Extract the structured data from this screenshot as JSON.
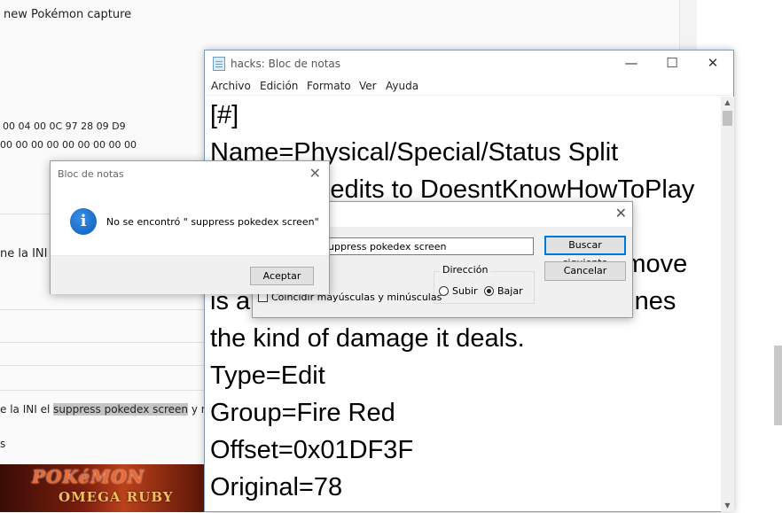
{
  "background_page": {
    "top_text": "new Pokémon capture",
    "hex_line_1": "00 04 00 0C 97 28 09 D9",
    "hex_line_2": "00 00 00 00 00 00 00 00 00",
    "partial_text_1": "ne la INI e",
    "partial_prefix": "e la INI el ",
    "highlight_text": "suppress pokedex screen",
    "partial_suffix": " y n",
    "edge_text": "s",
    "banner_title": "POKéMON",
    "banner_subtitle": "OMEGA RUBY"
  },
  "notepad": {
    "title": "hacks: Bloc de notas",
    "window_controls": {
      "minimize": "—",
      "maximize": "☐",
      "close": "✕"
    },
    "menu": [
      "Archivo",
      "Edición",
      "Formato",
      "Ver",
      "Ayuda"
    ],
    "lines": [
      "[#]",
      "Name=Physical/Special/Status Split",
      "             Credits to DoesntKnowHowToPlay",
      "",
      "                                                          move",
      "is a                                                  mines",
      "the kind of damage it deals.",
      "Type=Edit",
      "Group=Fire Red",
      "Offset=0x01DF3F",
      "Original=78"
    ]
  },
  "find_dialog": {
    "close": "✕",
    "search_value": "uppress pokedex screen",
    "find_next_button": "Buscar siguiente",
    "cancel_button": "Cancelar",
    "direction_label": "Dirección",
    "direction_up": "Subir",
    "direction_down": "Bajar",
    "selected_direction": "Bajar",
    "match_case_label": "Coincidir mayúsculas y minúsculas",
    "match_case_checked": false
  },
  "message_box": {
    "title": "Bloc de notas",
    "close": "✕",
    "icon_glyph": "i",
    "message": "No se encontró \" suppress pokedex screen\"",
    "ok_button": "Aceptar"
  },
  "colors": {
    "accent": "#0078d7",
    "info_icon": "#1a6fd0",
    "highlight": "#c4c4c4"
  }
}
